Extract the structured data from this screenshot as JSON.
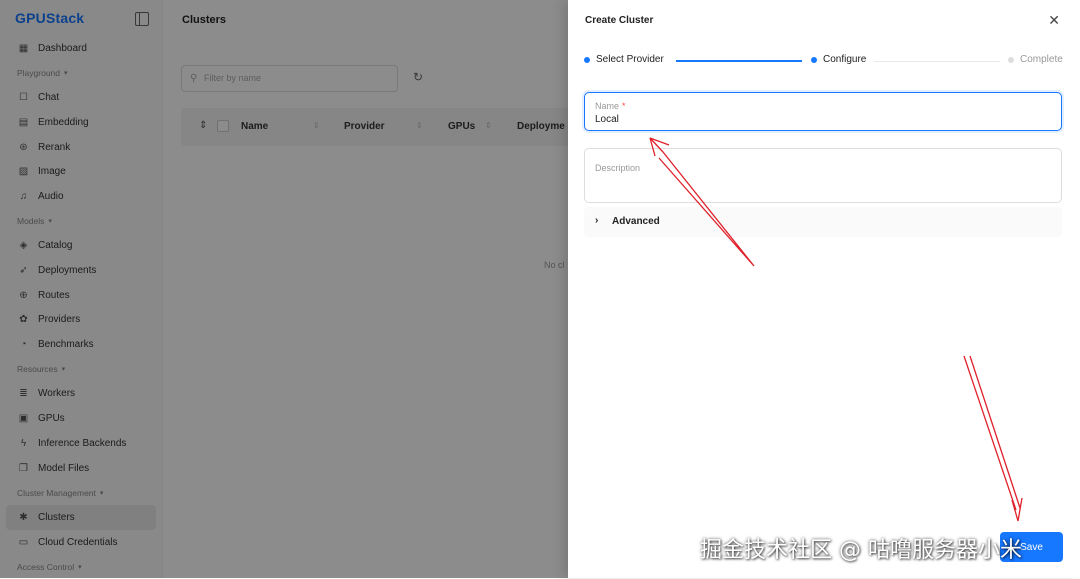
{
  "app": {
    "brand": "GPUStack"
  },
  "sidebar": {
    "items": [
      {
        "type": "item",
        "label": "Dashboard",
        "icon": "grid-icon",
        "glyph": "▦"
      },
      {
        "type": "group",
        "label": "Playground"
      },
      {
        "type": "item",
        "label": "Chat",
        "icon": "chat-icon",
        "glyph": "☐"
      },
      {
        "type": "item",
        "label": "Embedding",
        "icon": "embedding-icon",
        "glyph": "▤"
      },
      {
        "type": "item",
        "label": "Rerank",
        "icon": "rerank-icon",
        "glyph": "⊛"
      },
      {
        "type": "item",
        "label": "Image",
        "icon": "image-icon",
        "glyph": "▨"
      },
      {
        "type": "item",
        "label": "Audio",
        "icon": "audio-icon",
        "glyph": "♫"
      },
      {
        "type": "group",
        "label": "Models"
      },
      {
        "type": "item",
        "label": "Catalog",
        "icon": "layers-icon",
        "glyph": "◈"
      },
      {
        "type": "item",
        "label": "Deployments",
        "icon": "rocket-icon",
        "glyph": "➶"
      },
      {
        "type": "item",
        "label": "Routes",
        "icon": "globe-icon",
        "glyph": "⊕"
      },
      {
        "type": "item",
        "label": "Providers",
        "icon": "providers-icon",
        "glyph": "✿"
      },
      {
        "type": "item",
        "label": "Benchmarks",
        "icon": "gauge-icon",
        "glyph": "◔"
      },
      {
        "type": "group",
        "label": "Resources"
      },
      {
        "type": "item",
        "label": "Workers",
        "icon": "server-icon",
        "glyph": "≣"
      },
      {
        "type": "item",
        "label": "GPUs",
        "icon": "chip-icon",
        "glyph": "▣"
      },
      {
        "type": "item",
        "label": "Inference Backends",
        "icon": "bolt-icon",
        "glyph": "ϟ"
      },
      {
        "type": "item",
        "label": "Model Files",
        "icon": "files-icon",
        "glyph": "❐"
      },
      {
        "type": "group",
        "label": "Cluster Management"
      },
      {
        "type": "item",
        "label": "Clusters",
        "icon": "cluster-icon",
        "glyph": "✱",
        "active": true
      },
      {
        "type": "item",
        "label": "Cloud Credentials",
        "icon": "credential-icon",
        "glyph": "▭"
      },
      {
        "type": "group",
        "label": "Access Control"
      }
    ]
  },
  "main": {
    "title": "Clusters",
    "filter_placeholder": "Filter by name",
    "columns": [
      "Name",
      "Provider",
      "GPUs",
      "Deployme"
    ],
    "empty_text": "No cl"
  },
  "drawer": {
    "title": "Create Cluster",
    "steps": [
      {
        "label": "Select Provider",
        "state": "done"
      },
      {
        "label": "Configure",
        "state": "active"
      },
      {
        "label": "Complete",
        "state": "pending"
      }
    ],
    "name_label": "Name",
    "name_required_mark": "*",
    "name_value": "Local",
    "description_placeholder": "Description",
    "advanced_label": "Advanced",
    "save_label": "Save"
  },
  "watermark": "掘金技术社区 @ 咕噜服务器小米",
  "colors": {
    "accent": "#1677ff",
    "annotation": "#e0202a"
  }
}
